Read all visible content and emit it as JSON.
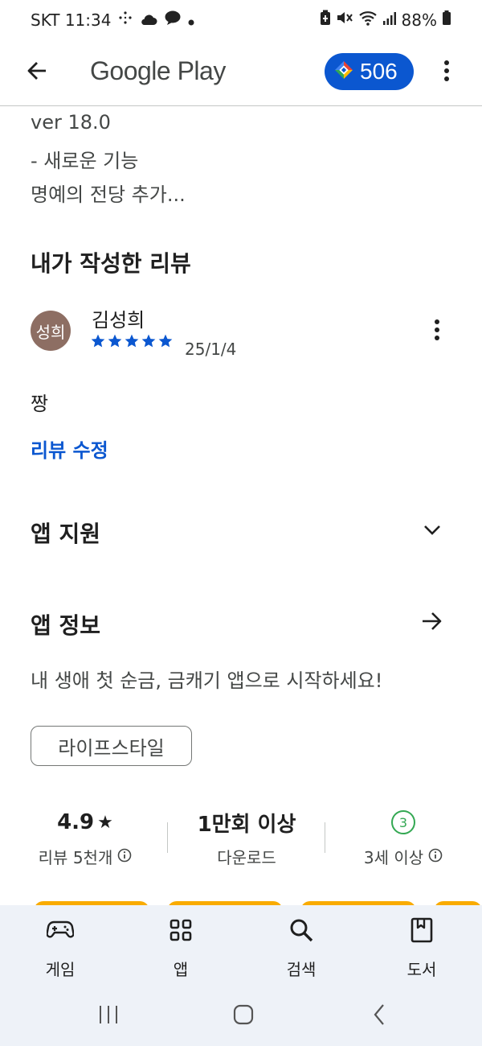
{
  "status_bar": {
    "carrier_time": "SKT 11:34",
    "battery": "88%",
    "icons": [
      "sparkle-dots-icon",
      "cloud-icon",
      "chat-bubble-icon",
      "dot-icon",
      "battery-saver-icon",
      "mute-icon",
      "wifi-icon",
      "signal-icon",
      "battery-icon"
    ]
  },
  "app_bar": {
    "title": "Google Play",
    "points": "506",
    "icons": [
      "back-arrow-icon",
      "play-points-diamond-icon",
      "more-vert-icon"
    ]
  },
  "whats_new": {
    "lines": [
      "ver 18.0",
      "- 새로운 기능",
      "명예의 전당 추가..."
    ]
  },
  "my_review": {
    "title": "내가 작성한 리뷰",
    "avatar_text": "성희",
    "name": "김성희",
    "rating": 5,
    "date": "25/1/4",
    "text": "짱",
    "edit_label": "리뷰 수정"
  },
  "app_support": {
    "title": "앱 지원"
  },
  "app_info": {
    "title": "앱 정보",
    "description": "내 생애 첫 순금, 금캐기 앱으로 시작하세요!",
    "category": "라이프스타일"
  },
  "stats": {
    "rating": "4.9",
    "rating_star": "★",
    "reviews": "리뷰 5천개",
    "downloads": "1만회 이상",
    "downloads_label": "다운로드",
    "age_badge": "3",
    "age_label": "3세 이상"
  },
  "bottom_nav": {
    "items": [
      {
        "label": "게임",
        "icon": "gamepad-icon"
      },
      {
        "label": "앱",
        "icon": "apps-grid-icon"
      },
      {
        "label": "검색",
        "icon": "search-icon"
      },
      {
        "label": "도서",
        "icon": "book-icon"
      }
    ]
  },
  "colors": {
    "accent": "#0b57d0",
    "age_badge": "#34a853",
    "avatar": "#8d6e63",
    "nav_background": "#eef2f8"
  }
}
